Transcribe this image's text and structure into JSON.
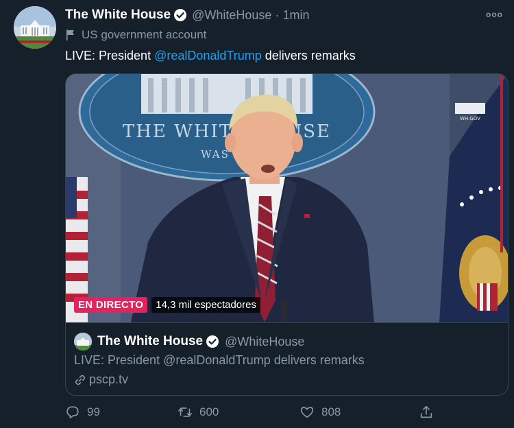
{
  "tweet": {
    "display_name": "The White House",
    "handle": "@WhiteHouse",
    "separator": "·",
    "time": "1min",
    "more_glyph": "ooo",
    "gov_label": "US government account",
    "text_prefix": "LIVE: President ",
    "text_mention": "@realDonaldTrump",
    "text_suffix": " delivers remarks"
  },
  "card": {
    "live_badge": "EN DIRECTO",
    "viewers": "14,3 mil espectadores",
    "display_name": "The White House",
    "handle": "@WhiteHouse",
    "text": "LIVE: President @realDonaldTrump delivers remarks",
    "link": "pscp.tv",
    "video_sign_text": "THE WHITE HOUSE",
    "video_sign_sub": "WAS",
    "video_watermark": "WH.GOV"
  },
  "actions": {
    "replies": "99",
    "retweets": "600",
    "likes": "808"
  },
  "colors": {
    "background": "#15202b",
    "accent": "#1da1f2",
    "muted": "#8899a6",
    "border": "#38444d",
    "live": "#e0245e"
  },
  "icons": [
    "verified-badge-icon",
    "government-flag-icon",
    "more-icon",
    "link-icon",
    "reply-icon",
    "retweet-icon",
    "like-icon",
    "share-icon"
  ]
}
